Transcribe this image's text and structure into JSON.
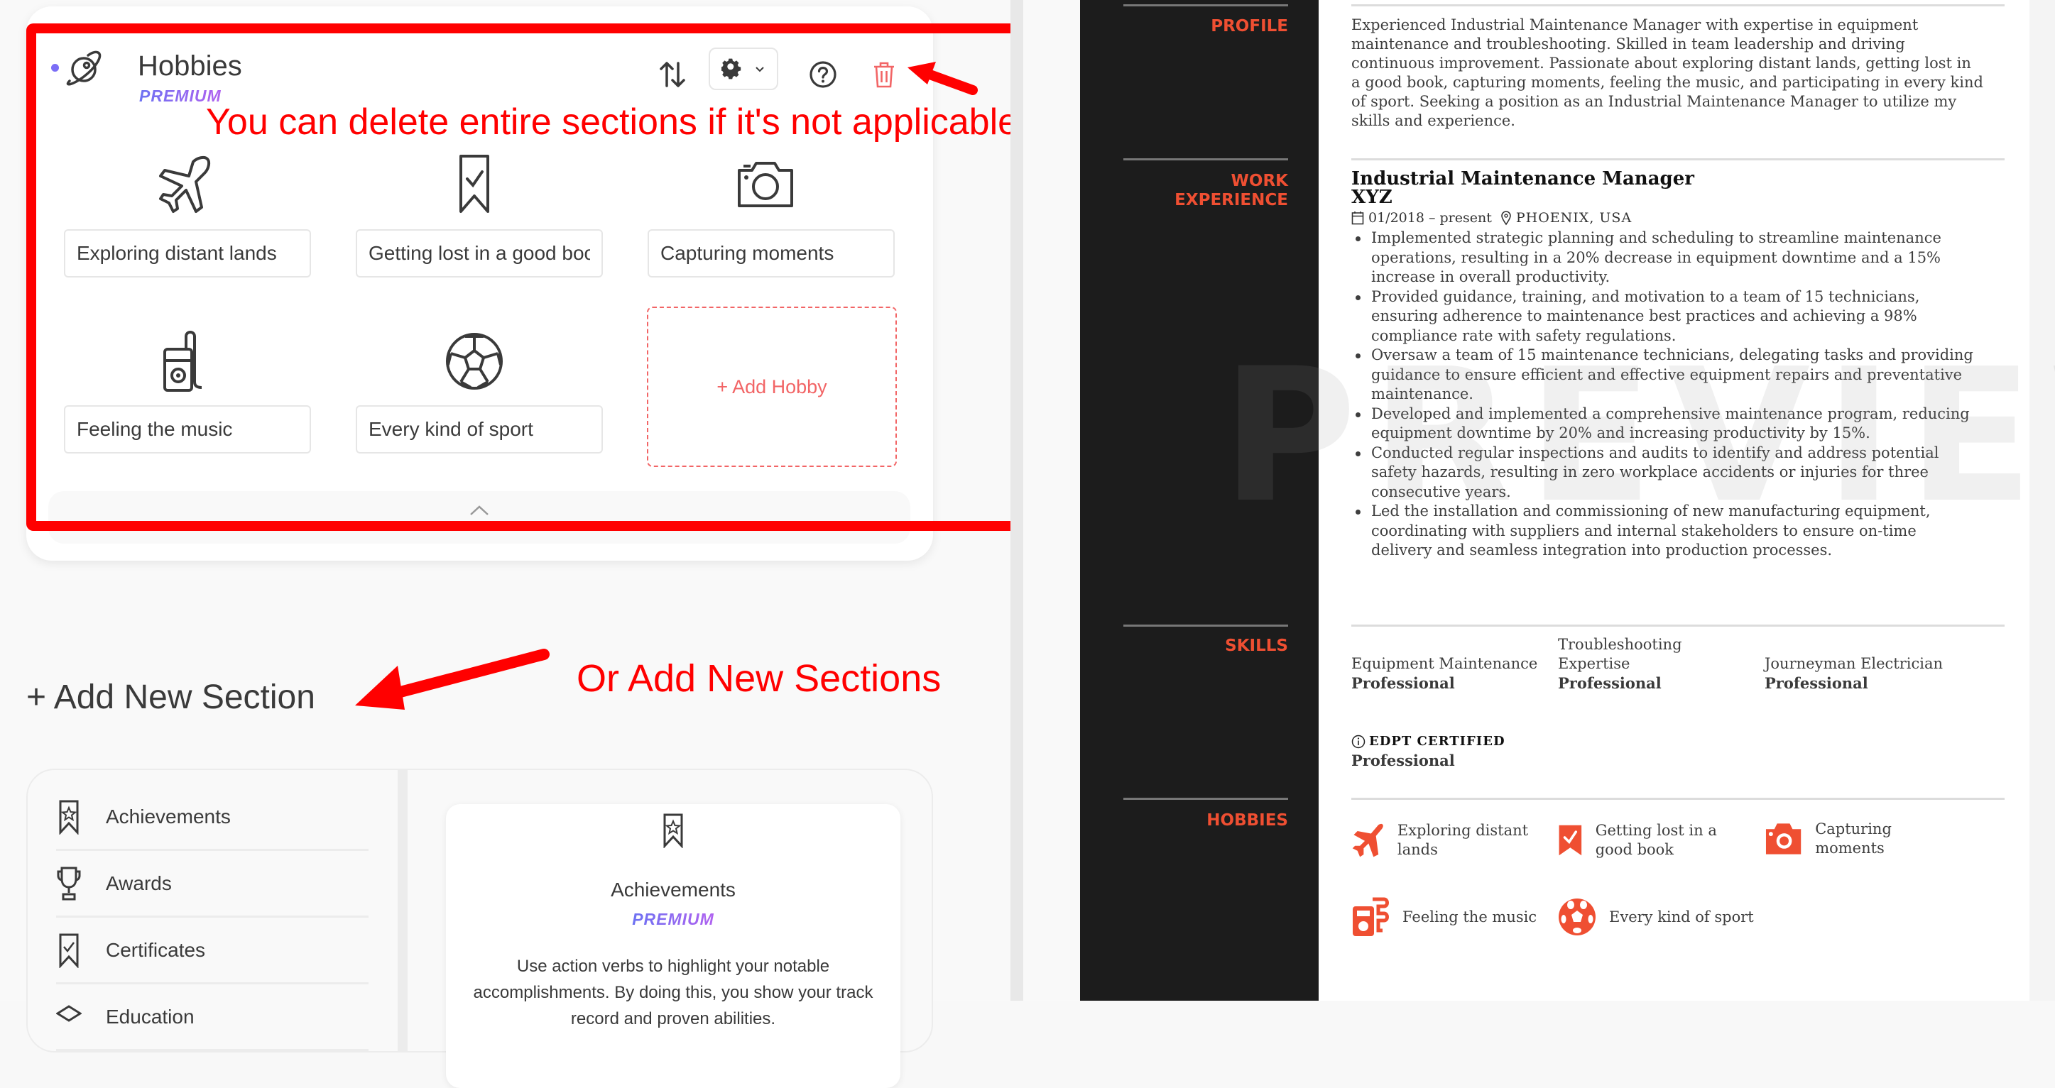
{
  "editor": {
    "section": {
      "title": "Hobbies",
      "badge": "PREMIUM",
      "toolbar": {
        "reorder_icon": "sort-arrows-icon",
        "settings_icon": "gear-icon",
        "help_icon": "question-circle-icon",
        "delete_icon": "trash-icon"
      },
      "hobbies": [
        {
          "icon": "airplane-icon",
          "value": "Exploring distant lands"
        },
        {
          "icon": "bookmark-check-icon",
          "value": "Getting lost in a good book"
        },
        {
          "icon": "camera-icon",
          "value": "Capturing moments"
        },
        {
          "icon": "music-player-icon",
          "value": "Feeling the music"
        },
        {
          "icon": "soccer-ball-icon",
          "value": "Every kind of sport"
        }
      ],
      "add_hobby_label": "+ Add Hobby"
    },
    "add_section_label": "+ Add New Section",
    "new_sections": {
      "items": [
        {
          "icon": "ribbon-star-icon",
          "label": "Achievements"
        },
        {
          "icon": "trophy-icon",
          "label": "Awards"
        },
        {
          "icon": "ribbon-check-icon",
          "label": "Certificates"
        },
        {
          "icon": "graduation-cap-icon",
          "label": "Education"
        }
      ],
      "preview": {
        "title": "Achievements",
        "badge": "PREMIUM",
        "description": "Use action verbs to highlight your notable accomplishments. By doing this, you show your track record and proven abilities."
      }
    }
  },
  "annotations": {
    "delete_note": "You can delete entire sections if it's not applicable.",
    "add_note": "Or Add New Sections"
  },
  "resume": {
    "watermark": "PREVIEW",
    "accent_color": "#ef4f32",
    "profile": {
      "heading": "PROFILE",
      "text": "Experienced Industrial Maintenance Manager with expertise in equipment maintenance and troubleshooting. Skilled in team leadership and driving continuous improvement. Passionate about exploring distant lands, getting lost in a good book, capturing moments, feeling the music, and participating in every kind of sport. Seeking a position as an Industrial Maintenance Manager to utilize my skills and experience."
    },
    "work": {
      "heading_line1": "WORK",
      "heading_line2": "EXPERIENCE",
      "job_title": "Industrial Maintenance Manager",
      "company": "XYZ",
      "dates": "01/2018 – present",
      "location": "PHOENIX, USA",
      "bullets": [
        "Implemented strategic planning and scheduling to streamline maintenance operations, resulting in a 20% decrease in equipment downtime and a 15% increase in overall productivity.",
        "Provided guidance, training, and motivation to a team of 15 technicians, ensuring adherence to maintenance best practices and achieving a 98% compliance rate with safety regulations.",
        "Oversaw a team of 15 maintenance technicians, delegating tasks and providing guidance to ensure efficient and effective equipment repairs and preventative maintenance.",
        "Developed and implemented a comprehensive maintenance program, reducing equipment downtime by 20% and increasing productivity by 15%.",
        "Conducted regular inspections and audits to identify and address potential safety hazards, resulting in zero workplace accidents or injuries for three consecutive years.",
        "Led the installation and commissioning of new manufacturing equipment, coordinating with suppliers and internal stakeholders to ensure on-time delivery and seamless integration into production processes."
      ]
    },
    "skills": {
      "heading": "SKILLS",
      "items": [
        {
          "name": "Equipment Maintenance",
          "level": "Professional"
        },
        {
          "name": "Troubleshooting Expertise",
          "level": "Professional"
        },
        {
          "name": "Journeyman Electrician",
          "level": "Professional"
        }
      ],
      "certification": {
        "name": "EDPT CERTIFIED",
        "level": "Professional"
      }
    },
    "hobbies": {
      "heading": "HOBBIES",
      "items": [
        {
          "icon": "airplane-icon",
          "label": "Exploring distant lands"
        },
        {
          "icon": "bookmark-check-icon",
          "label": "Getting lost in a good book"
        },
        {
          "icon": "camera-icon",
          "label": "Capturing moments"
        },
        {
          "icon": "music-player-icon",
          "label": "Feeling the music"
        },
        {
          "icon": "soccer-ball-icon",
          "label": "Every kind of sport"
        }
      ]
    }
  }
}
